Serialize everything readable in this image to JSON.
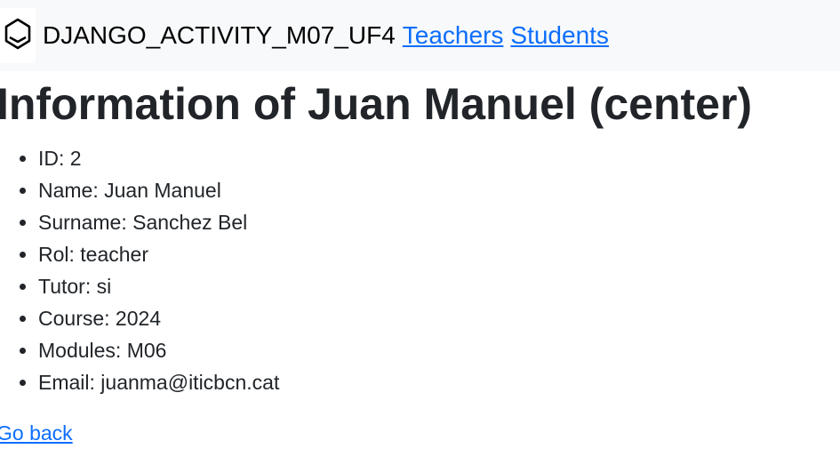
{
  "navbar": {
    "logo_icon": "hexagon-logo-icon",
    "brand": "DJANGO_ACTIVITY_M07_UF4",
    "links": [
      {
        "label": "Teachers"
      },
      {
        "label": "Students"
      }
    ]
  },
  "main": {
    "title": "Information of Juan Manuel (center)",
    "details": [
      {
        "text": "ID: 2"
      },
      {
        "text": "Name: Juan Manuel"
      },
      {
        "text": "Surname: Sanchez Bel"
      },
      {
        "text": "Rol: teacher"
      },
      {
        "text": "Tutor: si"
      },
      {
        "text": "Course: 2024"
      },
      {
        "text": "Modules: M06"
      },
      {
        "text": "Email: juanma@iticbcn.cat"
      }
    ],
    "back_label": "Go back"
  },
  "colors": {
    "link": "#0d6efd",
    "navbar_bg": "#f8f9fa",
    "text": "#212529"
  }
}
